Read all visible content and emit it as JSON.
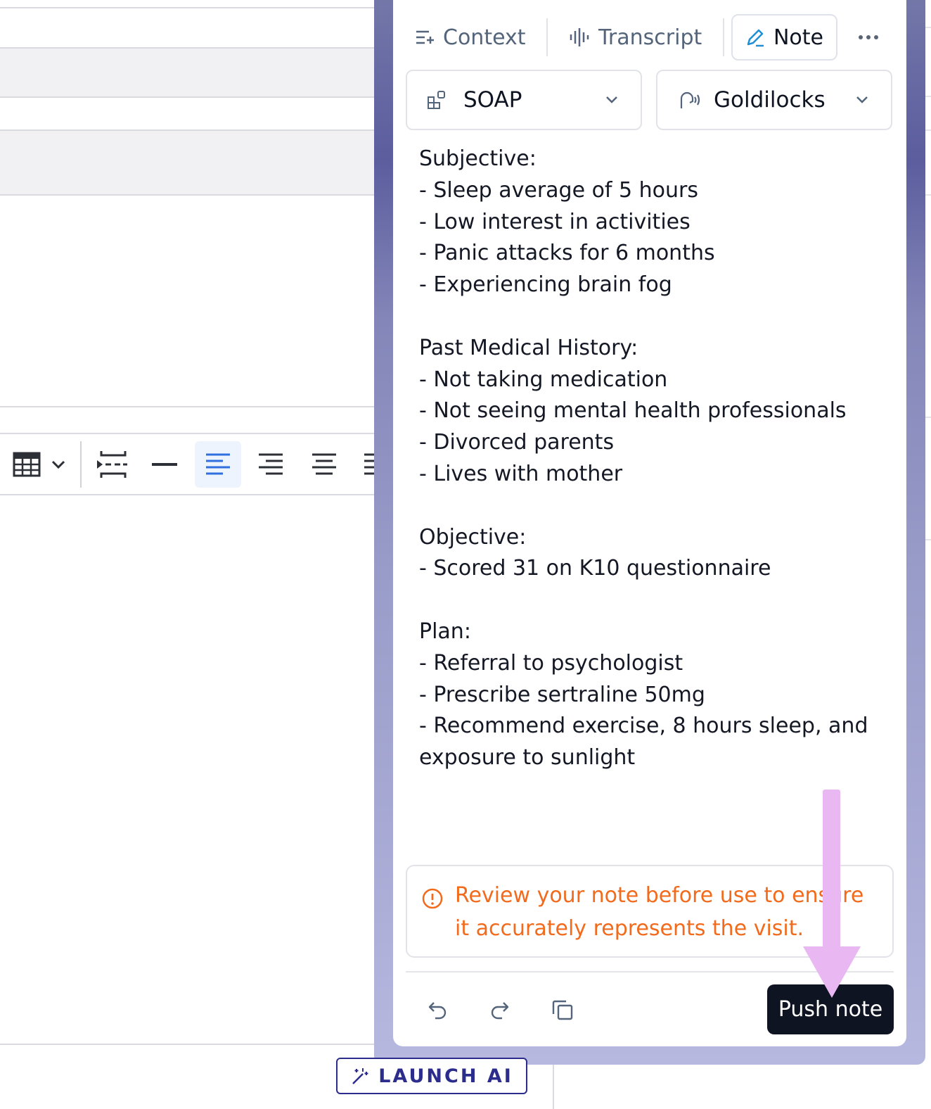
{
  "tabs": {
    "context": "Context",
    "transcript": "Transcript",
    "note": "Note",
    "more": "•••"
  },
  "selects": {
    "template": "SOAP",
    "style": "Goldilocks"
  },
  "note_lines": [
    "Subjective:",
    "- Sleep average of 5 hours",
    "- Low interest in activities",
    "- Panic attacks for 6 months",
    "- Experiencing brain fog",
    "",
    "Past Medical History:",
    "- Not taking medication",
    "- Not seeing mental health professionals",
    "- Divorced parents",
    "- Lives with mother",
    "",
    "Objective:",
    "- Scored 31 on K10 questionnaire",
    "",
    "Plan:",
    "- Referral to psychologist",
    "- Prescribe sertraline 50mg",
    "- Recommend exercise, 8 hours sleep, and",
    "exposure to sunlight"
  ],
  "warning": "Review your note before use to ensure it accurately represents the visit.",
  "actions": {
    "push": "Push note"
  },
  "launch": "LAUNCH AI",
  "colors": {
    "warning": "#f26b1d",
    "primary_button": "#0f1422",
    "active_align": "#2f6fe0",
    "annotation_arrow": "#e9b8f2",
    "launch_border": "#2b2c8c"
  },
  "icons": [
    "context-icon",
    "waveform-icon",
    "pencil-icon",
    "more-icon",
    "template-icon",
    "voice-icon",
    "chevron-down-icon",
    "alert-icon",
    "undo-icon",
    "redo-icon",
    "copy-icon",
    "magic-wand-icon",
    "table-icon",
    "page-break-icon",
    "horizontal-rule-icon",
    "align-left-icon",
    "align-right-icon",
    "align-center-icon"
  ]
}
